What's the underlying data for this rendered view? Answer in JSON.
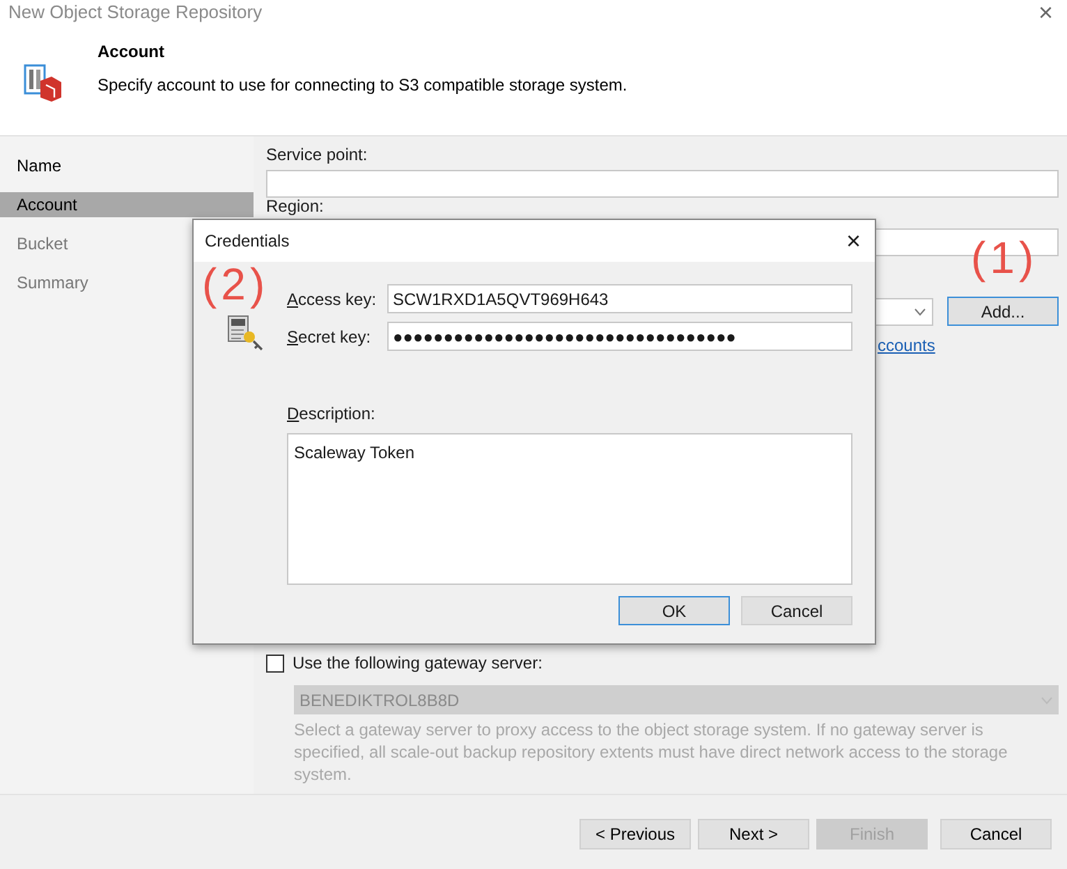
{
  "window": {
    "title": "New Object Storage Repository",
    "close": "×"
  },
  "header": {
    "title": "Account",
    "subtitle": "Specify account to use for connecting to S3 compatible storage system."
  },
  "sidebar": {
    "items": [
      {
        "label": "Name",
        "selected": false,
        "disabled": false
      },
      {
        "label": "Account",
        "selected": true,
        "disabled": false
      },
      {
        "label": "Bucket",
        "selected": false,
        "disabled": true
      },
      {
        "label": "Summary",
        "selected": false,
        "disabled": true
      }
    ]
  },
  "content": {
    "service_point": {
      "label": "Service point:"
    },
    "region": {
      "label": "Region:"
    },
    "add_button": "Add...",
    "accounts_link": "ccounts",
    "gateway": {
      "label": "Use the following gateway server:",
      "checked": false,
      "server": "BENEDIKTROL8B8D",
      "hint": "Select a gateway server to proxy access to the object storage system. If no gateway server is specified, all scale-out backup repository extents must have direct network access to the storage system."
    }
  },
  "buttons": [
    {
      "label": "< Previous",
      "disabled": false
    },
    {
      "label": "Next >",
      "disabled": false
    },
    {
      "label": "Finish",
      "disabled": true
    },
    {
      "label": "Cancel",
      "disabled": false
    }
  ],
  "dialog": {
    "title": "Credentials",
    "close": "×",
    "access_key": {
      "label": "Access key:",
      "value": "SCW1RXD1A5QVT969H643"
    },
    "secret_key": {
      "label": "Secret key:",
      "value": "●●●●●●●●●●●●●●●●●●●●●●●●●●●●●●●●●●"
    },
    "description": {
      "label": "Description:",
      "value": "Scaleway Token"
    },
    "buttons": [
      {
        "label": "OK",
        "default": true
      },
      {
        "label": "Cancel",
        "default": false
      }
    ]
  },
  "annotations": [
    "(1)",
    "(2)"
  ]
}
